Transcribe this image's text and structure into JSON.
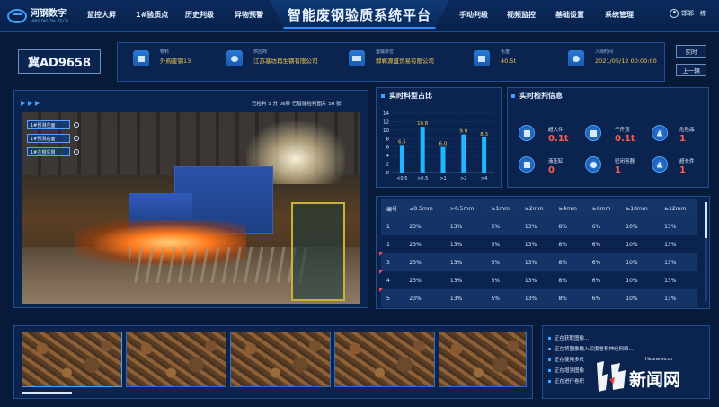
{
  "header": {
    "brand_name": "河钢数字",
    "brand_sub": "HBIS DIGITAL TECH",
    "title": "智能废钢验质系统平台",
    "nav_left": [
      "监控大屏",
      "1#验质点",
      "历史判级",
      "异物预警"
    ],
    "nav_right": [
      "手动判级",
      "视频监控",
      "基础设置",
      "系统管理"
    ],
    "user_name": "邯郸一练"
  },
  "info": {
    "plate": "冀AD9658",
    "items": [
      {
        "label": "物料",
        "value": "外购废钢13",
        "icon": "material-icon"
      },
      {
        "label": "供应商",
        "value": "江苏基坊再生钢有限公司",
        "icon": "supplier-icon"
      },
      {
        "label": "运输单位",
        "value": "邯郸源盛贸易有限公司",
        "icon": "truck-icon"
      },
      {
        "label": "毛重",
        "value": "40.5t",
        "icon": "weight-icon"
      },
      {
        "label": "入场时间",
        "value": "2021/05/12 00:00:00",
        "icon": "clock-icon"
      }
    ],
    "btn_realtime": "实时",
    "btn_prev": "上一辆"
  },
  "video": {
    "status": "已检判 5 分 06秒   已智能检判图片 50 张",
    "cameras": [
      "1#预测左面",
      "1#预测右面",
      "1#左侧车侧"
    ]
  },
  "chart_section": {
    "title": "实时料型占比"
  },
  "chart_data": {
    "type": "bar",
    "categories": [
      "<0.5",
      ">0.5",
      ">1",
      ">2",
      ">4"
    ],
    "values": [
      6.5,
      10.8,
      6.0,
      9.0,
      8.3
    ],
    "value_labels": [
      "6.5",
      "10.8",
      "6.0",
      "9.0",
      "8.3"
    ],
    "ylim": [
      0,
      14
    ],
    "yticks": [
      0,
      2,
      4,
      6,
      8,
      10,
      12,
      14
    ],
    "bar_color": "#1fb6ff",
    "label_color": "#f2c94c",
    "grid": true
  },
  "detect": {
    "title": "实时检判信息",
    "items": [
      {
        "label": "超大件",
        "value": "0.1t",
        "icon": "cube-icon"
      },
      {
        "label": "千斤顶",
        "value": "0.1t",
        "icon": "jack-icon"
      },
      {
        "label": "危险品",
        "value": "1",
        "icon": "warning-icon"
      },
      {
        "label": "液压缸",
        "value": "0",
        "icon": "cylinder-icon"
      },
      {
        "label": "密闭容器",
        "value": "1",
        "icon": "container-icon"
      },
      {
        "label": "超长件",
        "value": "1",
        "icon": "long-part-icon"
      }
    ]
  },
  "table": {
    "headers": [
      "编号",
      "≤0.5mm",
      ">0.5mm",
      "≥1mm",
      "≥2mm",
      "≥4mm",
      "≥6mm",
      "≥10mm",
      "≥12mm"
    ],
    "rows": [
      [
        "1",
        "23%",
        "13%",
        "5%",
        "13%",
        "8%",
        "6%",
        "10%",
        "13%"
      ],
      [
        "1",
        "23%",
        "13%",
        "5%",
        "13%",
        "8%",
        "6%",
        "10%",
        "13%"
      ],
      [
        "3",
        "23%",
        "13%",
        "5%",
        "13%",
        "8%",
        "6%",
        "10%",
        "13%"
      ],
      [
        "4",
        "23%",
        "13%",
        "5%",
        "13%",
        "8%",
        "6%",
        "10%",
        "13%"
      ],
      [
        "5",
        "23%",
        "13%",
        "5%",
        "13%",
        "8%",
        "6%",
        "10%",
        "13%"
      ]
    ]
  },
  "log": {
    "lines": [
      "正在获取图像...",
      "正在将图像输入深度卷积神经网络...",
      "正在使用多尺",
      "正在增强图像",
      "正在进行卷积"
    ]
  },
  "watermark": {
    "site": "Hebnews.cn",
    "text": "新闻网",
    "mark": "河北"
  },
  "colors": {
    "background": "#071a3a",
    "accent": "#2f8dff",
    "value_yellow": "#f2c94c",
    "alert_red": "#ff5a4e"
  }
}
